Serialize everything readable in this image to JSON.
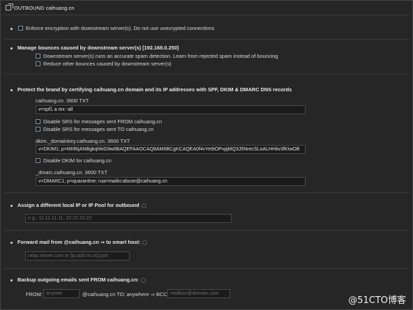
{
  "header": {
    "title": "OUTBOUND caihuang.cn"
  },
  "encryption": {
    "label": "Enforce encryption with downstream server(s). Do not use unecrypted connections"
  },
  "bounces": {
    "title": "Manage bounces caused by downstream server(s) [192.168.0.250]",
    "opt1": "Downstream server(s) runs an accurate spam detection. Learn from rejected spam instead of bouncing",
    "opt2": "Reduce other bounces caused by downstream server(s)"
  },
  "brand": {
    "title": "Protect the brand by certifying caihuang.cn domain and its IP addresses with SPF, DKIM & DMARC DNS records",
    "spf_label": "caihuang.cn. 3600 TXT",
    "spf_value": "v=spf1 a mx -all",
    "srs_from": "Disable SRS for messages sent FROM caihuang.cn",
    "srs_to": "Disable SRS for messages sent TO caihuang.cn",
    "dkim_label": "dkim._domainkey.caihuang.cn. 3600 TXT",
    "dkim_value": "v=DKIM1; p=MIIBIjANBgkqhkiG9w0BAQEFAAOCAQ8AMIIBCgKCAQEA0f4vYe9iOPvpjMQ3J5NrecSLoALHHIiv3fKiwOB",
    "dkim_disable": "Disable DKIM for caihuang.cn",
    "dmarc_label": "_dmarc.caihuang.cn. 3600 TXT",
    "dmarc_value": "v=DMARC1; p=quarantine; rua=mailto:abuse@caihuang.cn"
  },
  "ip_pool": {
    "title": "Assign a different local IP or IP Pool for outbound",
    "placeholder": "e.g.: 11.11.11.11, 22.22.22.22"
  },
  "forward": {
    "title": "Forward mail from @caihuang.cn ⇒ to smart host:",
    "placeholder": "relay.server.com or [ip.add.re.ss]:port"
  },
  "backup": {
    "title": "Backup outgoing emails sent FROM caihuang.cn:",
    "from_label": "FROM:",
    "from_placeholder": "anyone",
    "mid_label": "@caihuang.cn TO: anywhere ⇒ BCC:",
    "bcc_placeholder": "mailbox@domain.com"
  },
  "watermark": "@51CTO博客"
}
